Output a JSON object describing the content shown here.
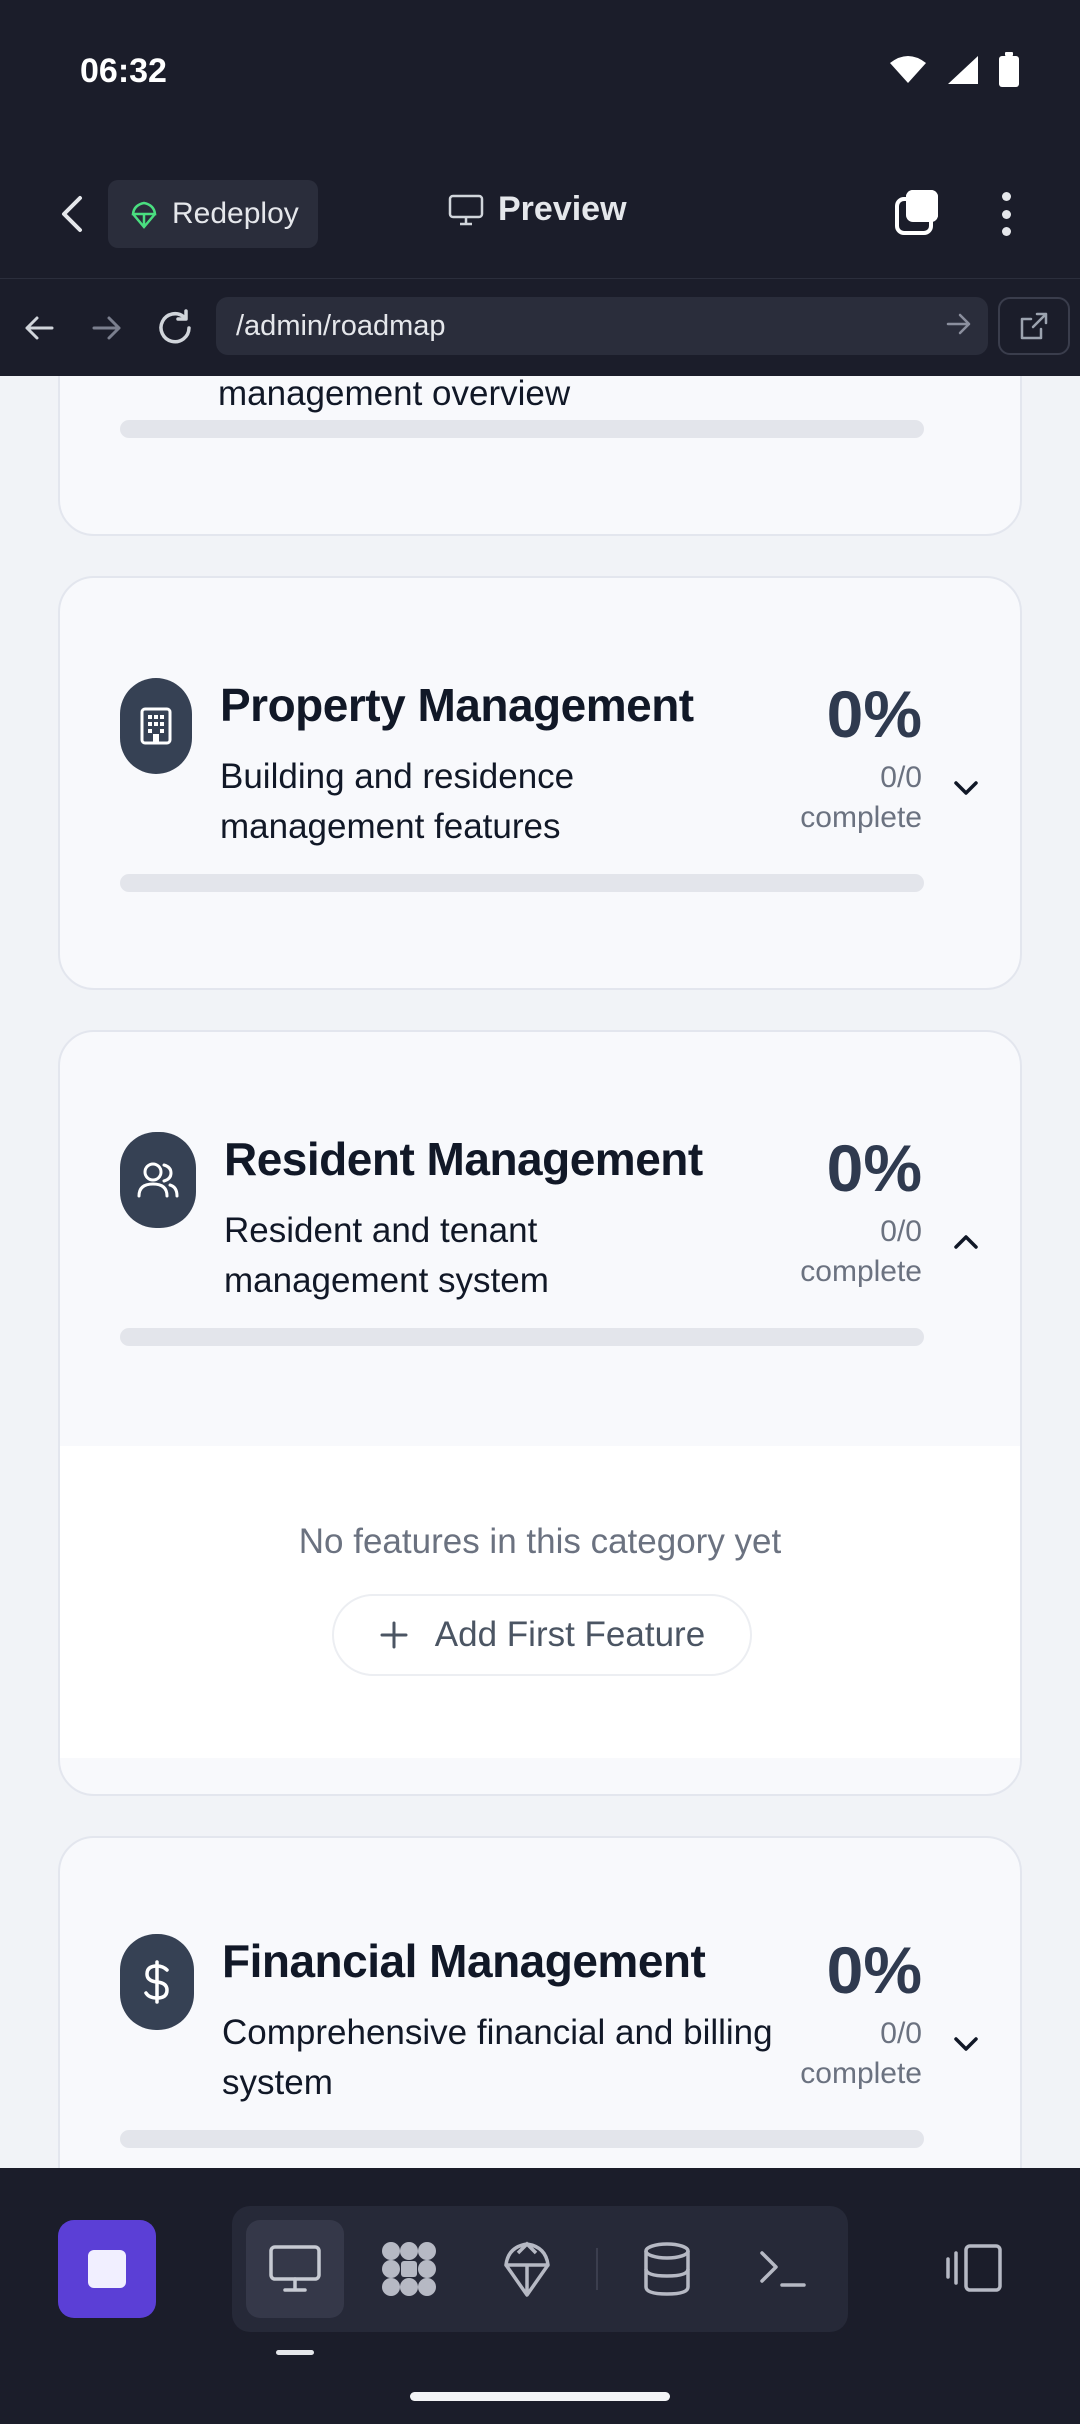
{
  "status_bar": {
    "time": "06:32"
  },
  "toolbar": {
    "redeploy_label": "Redeploy",
    "preview_label": "Preview"
  },
  "browser": {
    "url": "/admin/roadmap"
  },
  "categories": [
    {
      "title": "",
      "description": "management overview",
      "percent": "",
      "count": "",
      "complete_label": "",
      "progress": 0,
      "expanded": false
    },
    {
      "title": "Property Management",
      "description": "Building and residence management features",
      "percent": "0%",
      "count": "0/0",
      "complete_label": "complete",
      "icon": "building-icon",
      "progress": 0,
      "expanded": false
    },
    {
      "title": "Resident Management",
      "description": "Resident and tenant management system",
      "percent": "0%",
      "count": "0/0",
      "complete_label": "complete",
      "icon": "users-icon",
      "progress": 0,
      "expanded": true
    },
    {
      "title": "Financial Management",
      "description": "Comprehensive financial and billing system",
      "percent": "0%",
      "count": "0/0",
      "complete_label": "complete",
      "icon": "dollar-icon",
      "progress": 0,
      "expanded": false
    }
  ],
  "empty_state": {
    "message": "No features in this category yet",
    "add_button_label": "Add First Feature"
  },
  "bottom_bar": {
    "tools": [
      "preview-icon",
      "workflow-icon",
      "deploy-icon",
      "database-icon",
      "terminal-icon"
    ],
    "active_tool": "preview-icon"
  }
}
